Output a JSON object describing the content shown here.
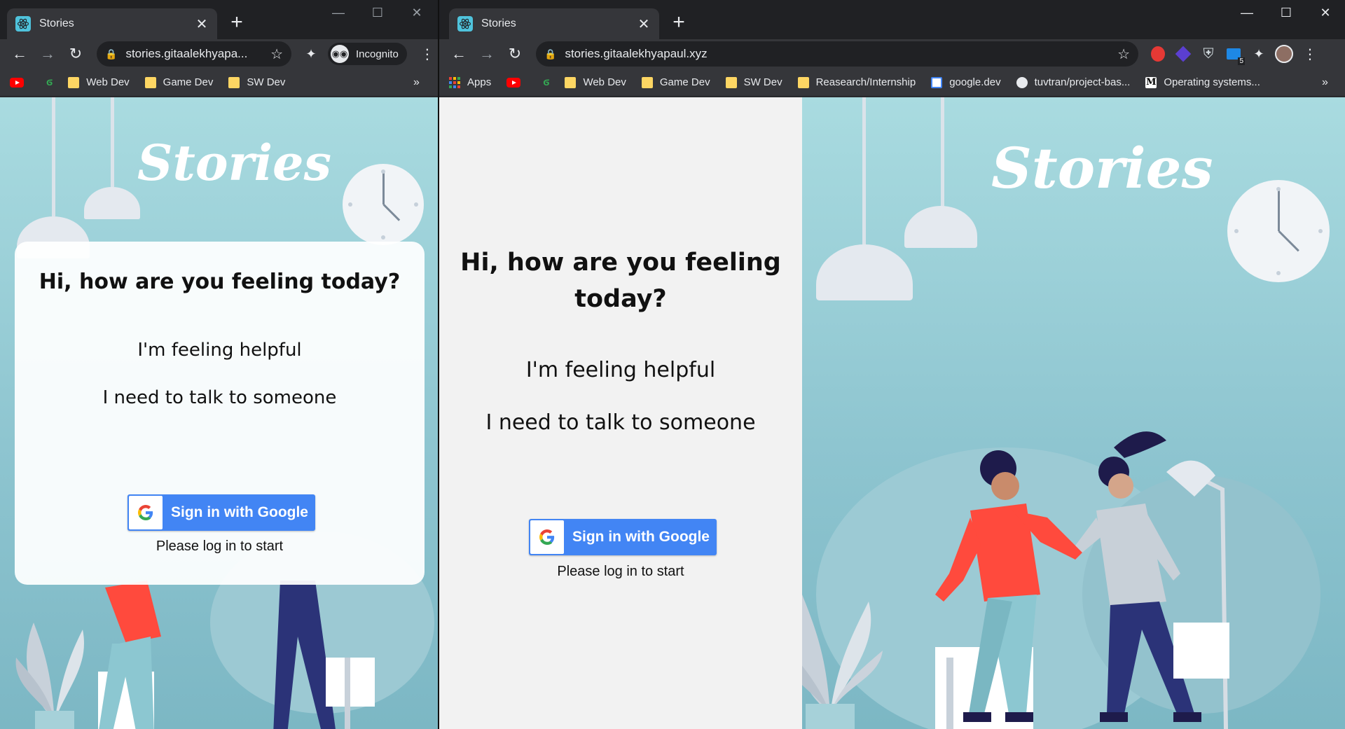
{
  "left_window": {
    "tab": {
      "title": "Stories",
      "close": "✕"
    },
    "new_tab": "+",
    "controls": {
      "minimize": "—",
      "maximize": "☐",
      "close": "✕"
    },
    "toolbar": {
      "url": "stories.gitaalekhyapa...",
      "incognito_label": "Incognito",
      "menu": "⋮"
    },
    "bookmarks": [
      {
        "label": "",
        "icon": "youtube-icon"
      },
      {
        "label": "",
        "icon": "green-s-icon"
      },
      {
        "label": "Web Dev",
        "icon": "folder-icon"
      },
      {
        "label": "Game Dev",
        "icon": "folder-icon"
      },
      {
        "label": "SW Dev",
        "icon": "folder-icon"
      }
    ],
    "bookmarks_overflow": "»",
    "page": {
      "logo": "Stories",
      "heading": "Hi, how are you feeling today?",
      "options": [
        "I'm feeling helpful",
        "I need to talk to someone"
      ],
      "signin_label": "Sign in with Google",
      "hint": "Please log in to start"
    }
  },
  "right_window": {
    "tab": {
      "title": "Stories",
      "close": "✕"
    },
    "new_tab": "+",
    "controls": {
      "minimize": "—",
      "maximize": "☐",
      "close": "✕"
    },
    "toolbar": {
      "url": "stories.gitaalekhyapaul.xyz",
      "menu": "⋮",
      "extension_badge": "5"
    },
    "bookmarks": [
      {
        "label": "Apps",
        "icon": "apps-grid-icon"
      },
      {
        "label": "",
        "icon": "youtube-icon"
      },
      {
        "label": "",
        "icon": "green-s-icon"
      },
      {
        "label": "Web Dev",
        "icon": "folder-icon"
      },
      {
        "label": "Game Dev",
        "icon": "folder-icon"
      },
      {
        "label": "SW Dev",
        "icon": "folder-icon"
      },
      {
        "label": "Reasearch/Internship",
        "icon": "folder-icon"
      },
      {
        "label": "google.dev",
        "icon": "google-dev-icon"
      },
      {
        "label": "tuvtran/project-bas...",
        "icon": "github-icon"
      },
      {
        "label": "Operating systems...",
        "icon": "medium-icon"
      }
    ],
    "bookmarks_overflow": "»",
    "page": {
      "logo": "Stories",
      "heading_line1": "Hi, how are you feeling",
      "heading_line2": "today?",
      "options": [
        "I'm feeling helpful",
        "I need to talk to someone"
      ],
      "signin_label": "Sign in with Google",
      "hint": "Please log in to start"
    }
  },
  "colors": {
    "chrome_dark": "#202124",
    "chrome_toolbar": "#35363a",
    "scene_sky": "#a9dbe0",
    "google_blue": "#4285f4",
    "highlight": "#b9e2e6",
    "panel_bg": "#f2f2f2"
  }
}
